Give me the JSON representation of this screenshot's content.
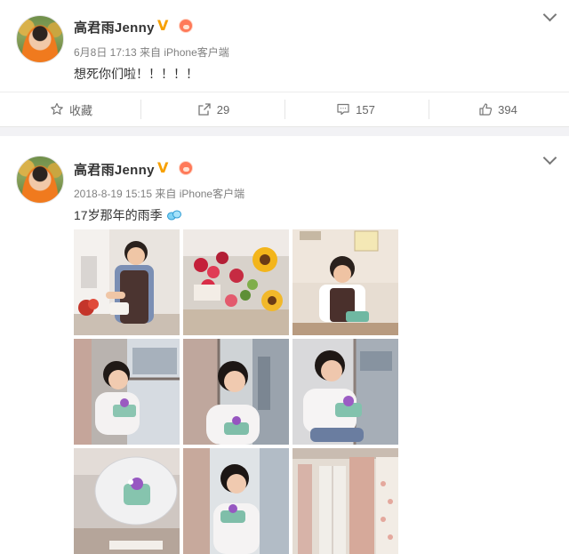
{
  "post1": {
    "author": "高君雨Jenny",
    "meta": "6月8日 17:13 来自 iPhone客户端",
    "text": "想死你们啦！！！！！",
    "actions": {
      "favorite_label": "收藏",
      "repost_count": "29",
      "comment_count": "157",
      "like_count": "394"
    }
  },
  "post2": {
    "author": "高君雨Jenny",
    "meta": "2018-8-19 15:15 来自 iPhone客户端",
    "text": "17岁那年的雨季",
    "photos": [
      {
        "name": "photo-girl-kitchen"
      },
      {
        "name": "photo-flowers-bouquet"
      },
      {
        "name": "photo-girl-table-cake"
      },
      {
        "name": "photo-window-cake-1"
      },
      {
        "name": "photo-window-cake-2"
      },
      {
        "name": "photo-window-cake-3"
      },
      {
        "name": "photo-cake-closeup"
      },
      {
        "name": "photo-girl-holding-cake"
      },
      {
        "name": "photo-balcony-curtain"
      }
    ]
  },
  "colors": {
    "accent_orange": "#f7a000",
    "meta_gray": "#808080",
    "separator": "#f2f2f5"
  },
  "icons": [
    "verified-v-icon",
    "user-level-icon",
    "chevron-down-icon",
    "star-icon",
    "share-icon",
    "comment-icon",
    "thumb-up-icon",
    "droplet-emoji-icon"
  ]
}
